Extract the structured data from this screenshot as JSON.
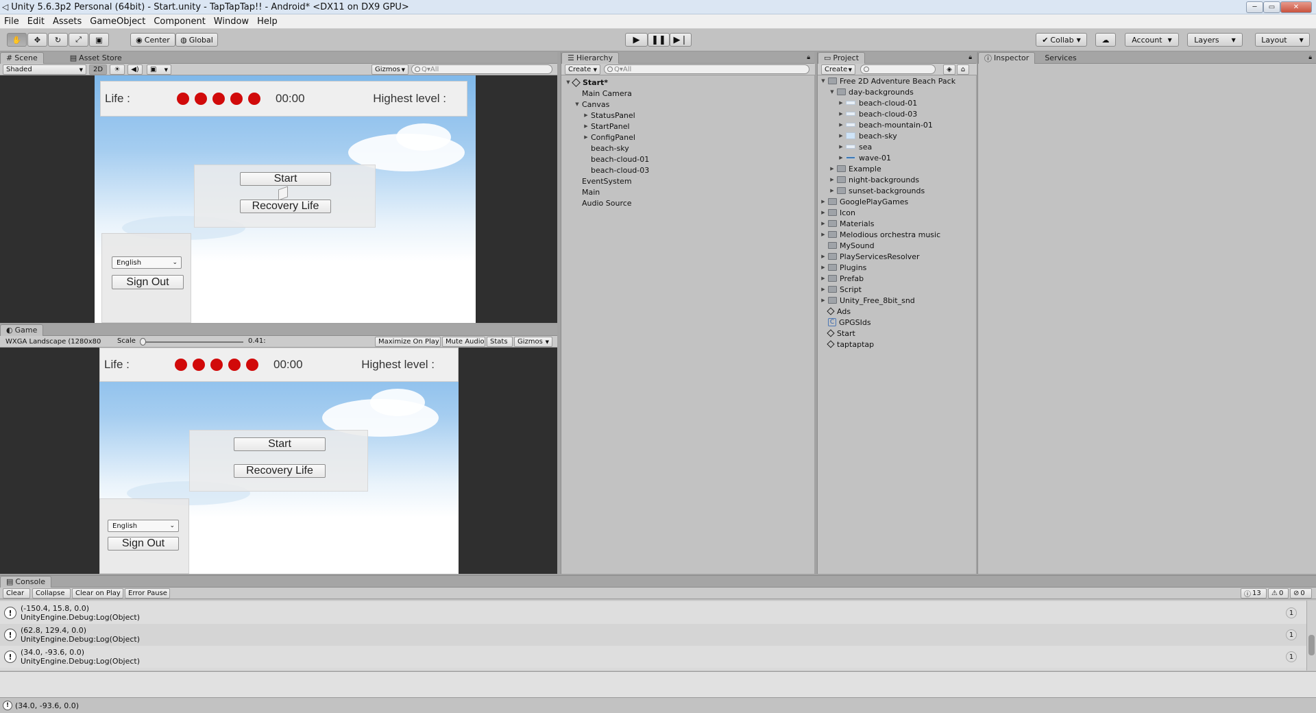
{
  "window": {
    "title": "Unity 5.6.3p2 Personal (64bit) - Start.unity - TapTapTap!! - Android* <DX11 on DX9 GPU>"
  },
  "menu": [
    "File",
    "Edit",
    "Assets",
    "GameObject",
    "Component",
    "Window",
    "Help"
  ],
  "toolbar": {
    "center": "Center",
    "global": "Global",
    "collab": "Collab",
    "account": "Account",
    "layers": "Layers",
    "layout": "Layout"
  },
  "scene": {
    "tab": "Scene",
    "tab2": "Asset Store",
    "shaded": "Shaded",
    "mode2d": "2D",
    "gizmos": "Gizmos",
    "search": "Q▾All"
  },
  "game": {
    "tab": "Game",
    "aspect": "WXGA Landscape (1280x80",
    "scale_label": "Scale",
    "scale_value": "0.41:",
    "maximize": "Maximize On Play",
    "mute": "Mute Audio",
    "stats": "Stats",
    "gizmos": "Gizmos"
  },
  "ui": {
    "life": "Life :",
    "time": "00:00",
    "highest": "Highest level :",
    "start": "Start",
    "recovery": "Recovery Life",
    "language": "English",
    "signout": "Sign Out",
    "lives": 5
  },
  "hierarchy": {
    "tab": "Hierarchy",
    "create": "Create",
    "search": "Q▾All",
    "items": [
      {
        "label": "Start*",
        "depth": 0,
        "arrow": "▼",
        "scene": true
      },
      {
        "label": "Main Camera",
        "depth": 1,
        "arrow": ""
      },
      {
        "label": "Canvas",
        "depth": 1,
        "arrow": "▼"
      },
      {
        "label": "StatusPanel",
        "depth": 2,
        "arrow": "▶"
      },
      {
        "label": "StartPanel",
        "depth": 2,
        "arrow": "▶"
      },
      {
        "label": "ConfigPanel",
        "depth": 2,
        "arrow": "▶"
      },
      {
        "label": "beach-sky",
        "depth": 2,
        "arrow": ""
      },
      {
        "label": "beach-cloud-01",
        "depth": 2,
        "arrow": ""
      },
      {
        "label": "beach-cloud-03",
        "depth": 2,
        "arrow": ""
      },
      {
        "label": "EventSystem",
        "depth": 1,
        "arrow": ""
      },
      {
        "label": "Main",
        "depth": 1,
        "arrow": ""
      },
      {
        "label": "Audio Source",
        "depth": 1,
        "arrow": ""
      }
    ]
  },
  "project": {
    "tab": "Project",
    "create": "Create",
    "items": [
      {
        "label": "Free 2D Adventure Beach Pack",
        "depth": 0,
        "arrow": "▼",
        "icon": "folder"
      },
      {
        "label": "day-backgrounds",
        "depth": 1,
        "arrow": "▼",
        "icon": "folder"
      },
      {
        "label": "beach-cloud-01",
        "depth": 2,
        "arrow": "▶",
        "icon": "sprite"
      },
      {
        "label": "beach-cloud-03",
        "depth": 2,
        "arrow": "▶",
        "icon": "sprite"
      },
      {
        "label": "beach-mountain-01",
        "depth": 2,
        "arrow": "▶",
        "icon": "sprite"
      },
      {
        "label": "beach-sky",
        "depth": 2,
        "arrow": "▶",
        "icon": "sprite-sky"
      },
      {
        "label": "sea",
        "depth": 2,
        "arrow": "▶",
        "icon": "sprite"
      },
      {
        "label": "wave-01",
        "depth": 2,
        "arrow": "▶",
        "icon": "sprite-wave"
      },
      {
        "label": "Example",
        "depth": 1,
        "arrow": "▶",
        "icon": "folder"
      },
      {
        "label": "night-backgrounds",
        "depth": 1,
        "arrow": "▶",
        "icon": "folder"
      },
      {
        "label": "sunset-backgrounds",
        "depth": 1,
        "arrow": "▶",
        "icon": "folder"
      },
      {
        "label": "GooglePlayGames",
        "depth": 0,
        "arrow": "▶",
        "icon": "folder"
      },
      {
        "label": "Icon",
        "depth": 0,
        "arrow": "▶",
        "icon": "folder"
      },
      {
        "label": "Materials",
        "depth": 0,
        "arrow": "▶",
        "icon": "folder"
      },
      {
        "label": "Melodious orchestra music",
        "depth": 0,
        "arrow": "▶",
        "icon": "folder"
      },
      {
        "label": "MySound",
        "depth": 0,
        "arrow": "",
        "icon": "folder"
      },
      {
        "label": "PlayServicesResolver",
        "depth": 0,
        "arrow": "▶",
        "icon": "folder"
      },
      {
        "label": "Plugins",
        "depth": 0,
        "arrow": "▶",
        "icon": "folder"
      },
      {
        "label": "Prefab",
        "depth": 0,
        "arrow": "▶",
        "icon": "folder"
      },
      {
        "label": "Script",
        "depth": 0,
        "arrow": "▶",
        "icon": "folder"
      },
      {
        "label": "Unity_Free_8bit_snd",
        "depth": 0,
        "arrow": "▶",
        "icon": "folder"
      },
      {
        "label": "Ads",
        "depth": 0,
        "arrow": "",
        "icon": "unity"
      },
      {
        "label": "GPGSIds",
        "depth": 0,
        "arrow": "",
        "icon": "cs"
      },
      {
        "label": "Start",
        "depth": 0,
        "arrow": "",
        "icon": "unity"
      },
      {
        "label": "taptaptap",
        "depth": 0,
        "arrow": "",
        "icon": "unity"
      }
    ]
  },
  "inspector": {
    "tab": "Inspector",
    "tab2": "Services"
  },
  "console": {
    "tab": "Console",
    "clear": "Clear",
    "collapse": "Collapse",
    "clear_on_play": "Clear on Play",
    "error_pause": "Error Pause",
    "counts": {
      "info": "13",
      "warn": "0",
      "error": "0"
    },
    "logs": [
      {
        "line1": "(-150.4, 15.8, 0.0)",
        "line2": "UnityEngine.Debug:Log(Object)",
        "count": "1"
      },
      {
        "line1": "(62.8, 129.4, 0.0)",
        "line2": "UnityEngine.Debug:Log(Object)",
        "count": "1"
      },
      {
        "line1": "(34.0, -93.6, 0.0)",
        "line2": "UnityEngine.Debug:Log(Object)",
        "count": "1"
      }
    ]
  },
  "statusbar": {
    "text": "(34.0, -93.6, 0.0)"
  }
}
